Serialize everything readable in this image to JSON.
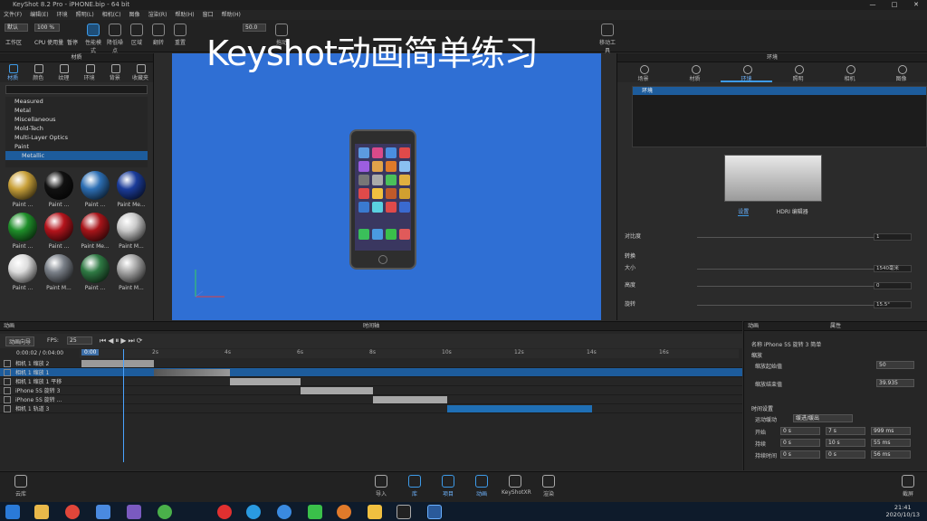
{
  "window": {
    "title": "KeyShot 8.2 Pro - iPHONE.bip - 64 bit",
    "controls": [
      "—",
      "□",
      "✕"
    ]
  },
  "overlay_title": "Keyshot动画简单练习",
  "menu": [
    "文件(F)",
    "编辑(E)",
    "环境",
    "照明(L)",
    "相机(C)",
    "图像",
    "渲染(R)",
    "帮助(H)",
    "窗口",
    "帮助(H)"
  ],
  "ribbon": {
    "workspace_label": "工作区",
    "workspace_value": "默认",
    "cpu_label": "CPU 使用量",
    "cpu_value": "100 %",
    "pause_label": "暂停",
    "perf_label": "性能模式",
    "tools": [
      "降低噪点",
      "区域",
      "翻转",
      "拖动",
      "移动工具"
    ],
    "reset_label": "重置",
    "zoom_value": "50.0"
  },
  "library": {
    "title": "库",
    "panel_title": "材质",
    "tabs": [
      "材质",
      "颜色",
      "纹理",
      "环境",
      "背景",
      "收藏夹"
    ],
    "tree": [
      "Measured",
      "Metal",
      "Miscellaneous",
      "Mold-Tech",
      "Multi-Layer Optics",
      "Paint",
      "Metallic"
    ],
    "thumbs": [
      {
        "label": "Paint ...",
        "color": "#c9a13a"
      },
      {
        "label": "Paint ...",
        "color": "#111111"
      },
      {
        "label": "Paint ...",
        "color": "#2d6fb4"
      },
      {
        "label": "Paint Me...",
        "color": "#1b3c9a"
      },
      {
        "label": "Paint ...",
        "color": "#1f8f2a"
      },
      {
        "label": "Paint ...",
        "color": "#b5141c"
      },
      {
        "label": "Paint Me...",
        "color": "#a8151a"
      },
      {
        "label": "Paint M...",
        "color": "#c9c9c9"
      },
      {
        "label": "Paint ...",
        "color": "#dcdcdc"
      },
      {
        "label": "Paint M...",
        "color": "#7a8088"
      },
      {
        "label": "Paint ...",
        "color": "#2f7a44"
      },
      {
        "label": "Paint M...",
        "color": "#a6a6a6"
      }
    ]
  },
  "project": {
    "title": "项目",
    "panel_title": "环境",
    "tabs": [
      "场景",
      "材质",
      "环境",
      "照明",
      "相机",
      "图像"
    ],
    "env_item": "环境",
    "env_tabs": [
      "设置",
      "HDRI 编辑器"
    ],
    "rows": [
      {
        "label": "对比度",
        "value": "1"
      },
      {
        "label": "转换",
        "value": ""
      },
      {
        "label": "大小",
        "value": "1540毫米"
      },
      {
        "label": "高度",
        "value": "0"
      },
      {
        "label": "旋转",
        "value": "15.5°"
      }
    ]
  },
  "timeline": {
    "panel_left": "动画",
    "title": "时间轴",
    "wizard": "动画向导",
    "fps_label": "FPS:",
    "fps_value": "25",
    "current_time": "0:00",
    "ticks": [
      "2s",
      "4s",
      "6s",
      "8s",
      "10s",
      "12s",
      "14s",
      "16s"
    ],
    "header": "0:00:02 / 0:04:00",
    "tracks": [
      "相机 1 缩放 2",
      "相机 1 缩放 1",
      "相机 1 缩放 1 平移",
      "iPhone 5S 旋转 3",
      "iPhone 5S 旋转 ...",
      "相机 1 轨道 3"
    ]
  },
  "properties": {
    "title": "属性",
    "panel_left": "动画",
    "name_label": "名称",
    "name_value": "iPhone 5S 旋转 3 简单",
    "section1": "缩放",
    "zoom_start_label": "缩放起始值",
    "zoom_start_value": "50",
    "zoom_end_label": "缩放结束值",
    "zoom_end_value": "39.935",
    "section2": "时间设置",
    "motion_label": "运动缓动",
    "motion_value": "缓进/缓出",
    "start_label": "开始",
    "start_values": [
      "0 s",
      "7 s",
      "999 ms"
    ],
    "dur_label": "持续",
    "dur_values": [
      "0 s",
      "10 s",
      "55 ms"
    ],
    "end_label": "持续时间",
    "end_values": [
      "0 s",
      "0 s",
      "56 ms"
    ]
  },
  "dock": [
    "导入",
    "库",
    "项目",
    "动画",
    "KeyShotXR",
    "渲染"
  ],
  "dock_left": "云库",
  "dock_right": "截屏",
  "clock": {
    "time": "21:41",
    "date": "2020/10/13"
  }
}
